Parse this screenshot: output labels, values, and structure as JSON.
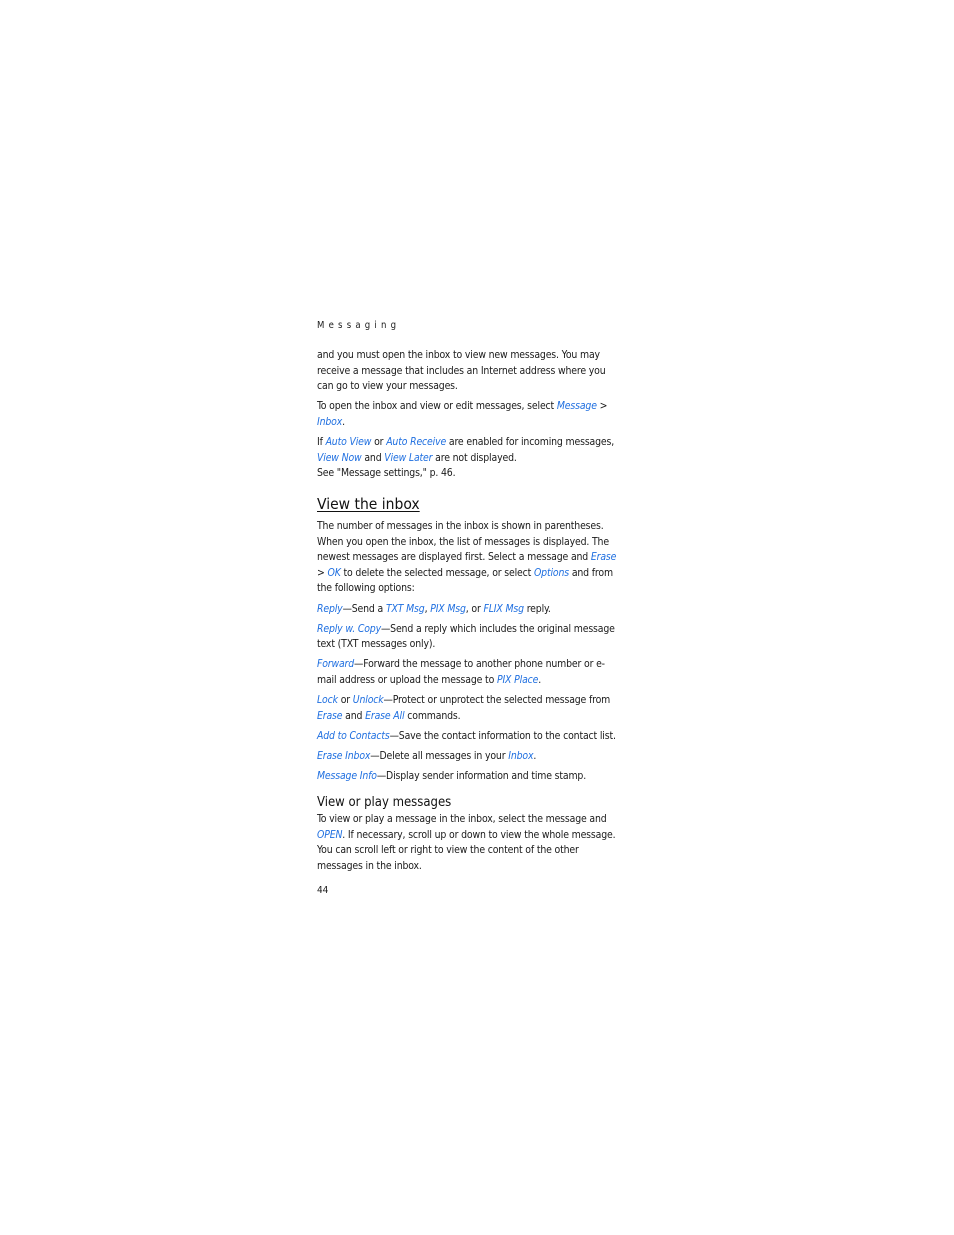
{
  "running_head": "Messaging",
  "intro": {
    "p1": "and you must open the inbox to view new messages. You may receive a message that includes an Internet address where you can go to view your messages.",
    "p2": {
      "text": "To open the inbox and view or edit messages, select ",
      "link1": "Message",
      "sep": " > ",
      "link2": "Inbox",
      "end": "."
    },
    "p3": {
      "t1": "If ",
      "link1": "Auto View",
      "t2": " or ",
      "link2": "Auto Receive",
      "t3": " are enabled for incoming messages, ",
      "link3": "View Now",
      "t4": " and ",
      "link4": "View Later",
      "t5": " are not displayed.",
      "t6": "See \"Message settings,\" p. 46."
    }
  },
  "section_inbox": {
    "heading": "View the inbox",
    "p1": {
      "t1": "The number of messages in the inbox is shown in parentheses. When you open the inbox, the list of messages is displayed. The newest messages are displayed first. Select a message and ",
      "link1": "Erase",
      "t2": " > ",
      "link2": "OK",
      "t3": " to delete the selected message, or select ",
      "link3": "Options",
      "t4": " and from the following options:"
    },
    "options": {
      "reply": {
        "label": "Reply",
        "t1": "—Send a ",
        "link1": "TXT Msg",
        "t2": ", ",
        "link2": "PIX Msg",
        "t3": ", or ",
        "link3": "FLIX Msg",
        "t4": " reply."
      },
      "reply_copy": {
        "label": "Reply w. Copy",
        "t1": "—Send a reply which includes the original message text (TXT messages only)."
      },
      "forward": {
        "label": "Forward",
        "t1": "—Forward the message to another phone number or e-mail address or upload the message to ",
        "link1": "PIX Place",
        "t2": "."
      },
      "lock": {
        "label": "Lock",
        "t1": " or ",
        "label2": "Unlock",
        "t2": "—Protect or unprotect the selected message from ",
        "link1": "Erase",
        "t3": " and ",
        "link2": "Erase All",
        "t4": " commands."
      },
      "add_contacts": {
        "label": "Add to Contacts",
        "t1": "—Save the contact information to the contact list."
      },
      "erase_inbox": {
        "label": "Erase Inbox",
        "t1": "—Delete all messages in your ",
        "link1": "Inbox",
        "t2": "."
      },
      "message_info": {
        "label": "Message Info",
        "t1": "—Display sender information and time stamp."
      }
    }
  },
  "section_play": {
    "heading": "View or play messages",
    "p1": {
      "t1": "To view or play a message in the inbox, select the message and ",
      "link1": "OPEN",
      "t2": ". If necessary, scroll up or down to view the whole message. You can scroll left or right to view the content of the other messages in the inbox."
    }
  },
  "page_number": "44",
  "colors": {
    "link": "#1f6fe0",
    "text": "#1a1a1a"
  }
}
